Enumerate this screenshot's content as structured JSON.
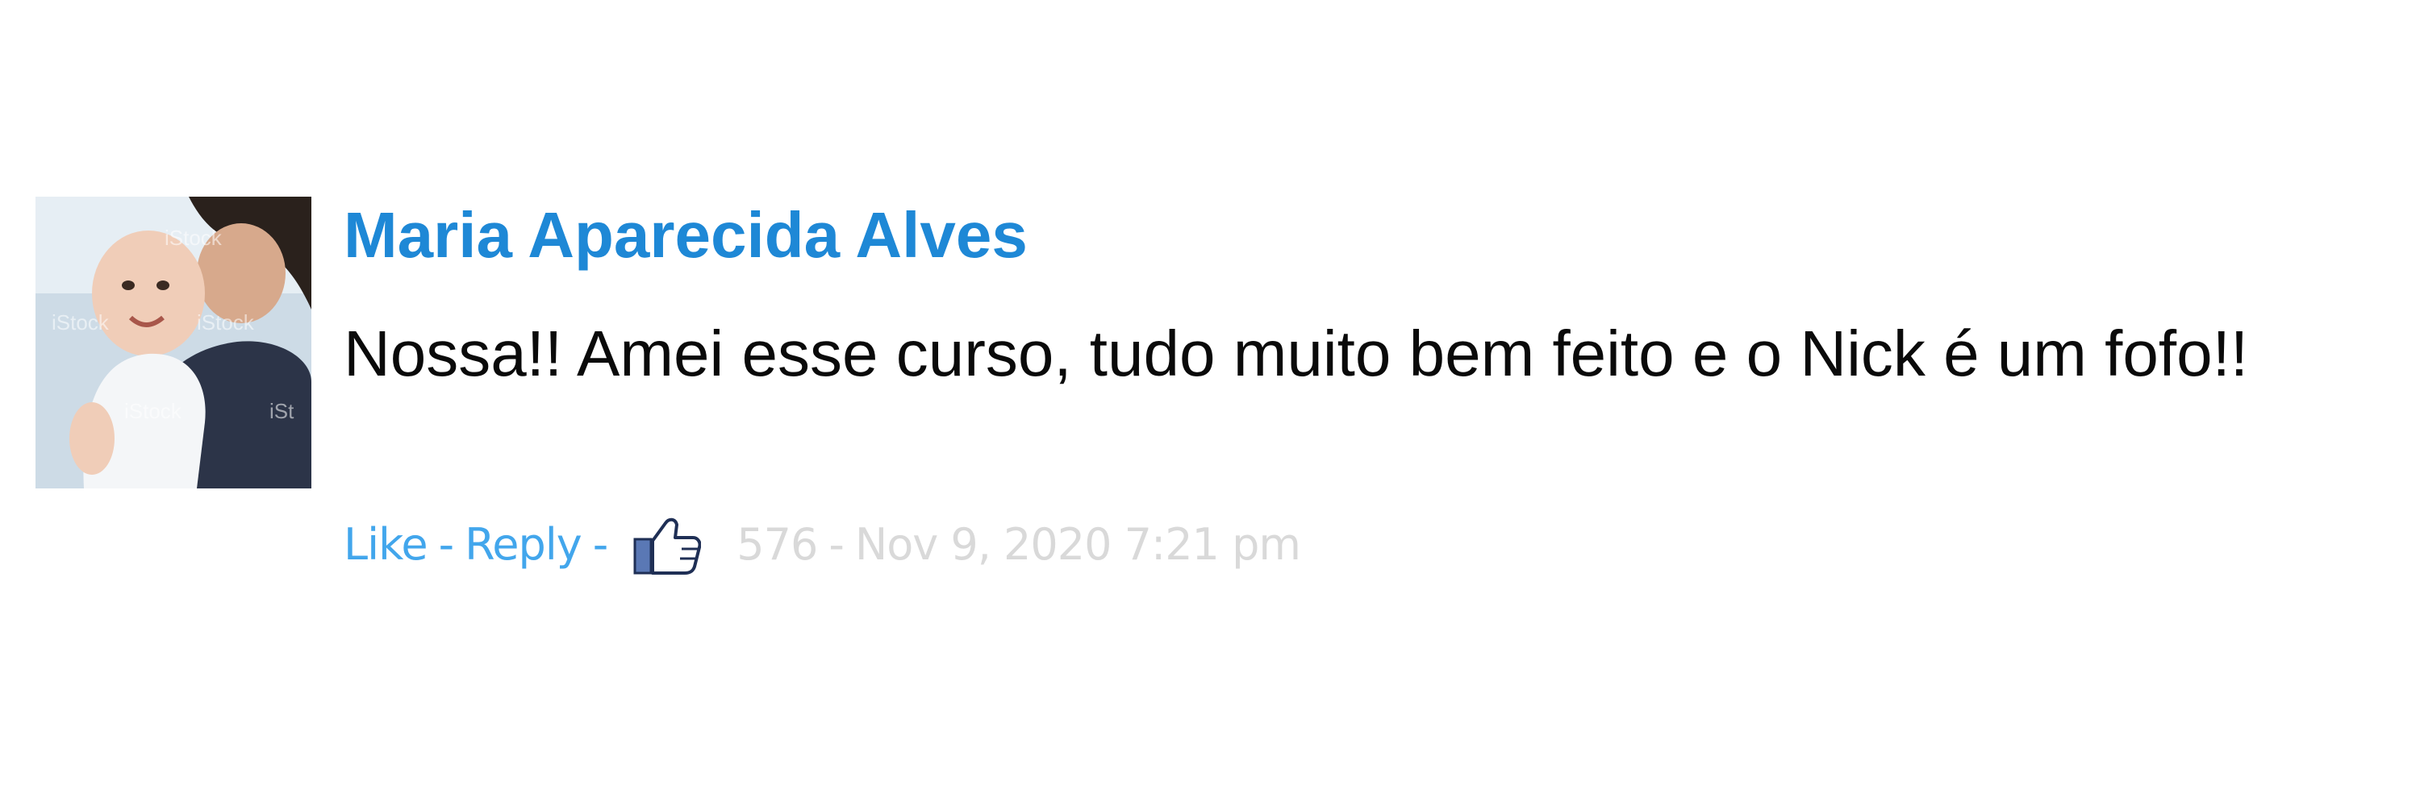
{
  "comment": {
    "author": "Maria Aparecida Alves",
    "text": "Nossa!! Amei esse curso, tudo muito bem feito e o Nick é um fofo!!",
    "avatar_icon": "profile-photo",
    "actions": {
      "like_label": "Like",
      "separator": "-",
      "reply_label": "Reply",
      "like_icon": "thumbs-up-icon",
      "like_count": "576",
      "timestamp": "Nov 9, 2020 7:21 pm"
    },
    "colors": {
      "author": "#1e88d6",
      "link": "#42a6ec",
      "meta": "#d9d9d9",
      "text": "#0a0a0a"
    }
  }
}
